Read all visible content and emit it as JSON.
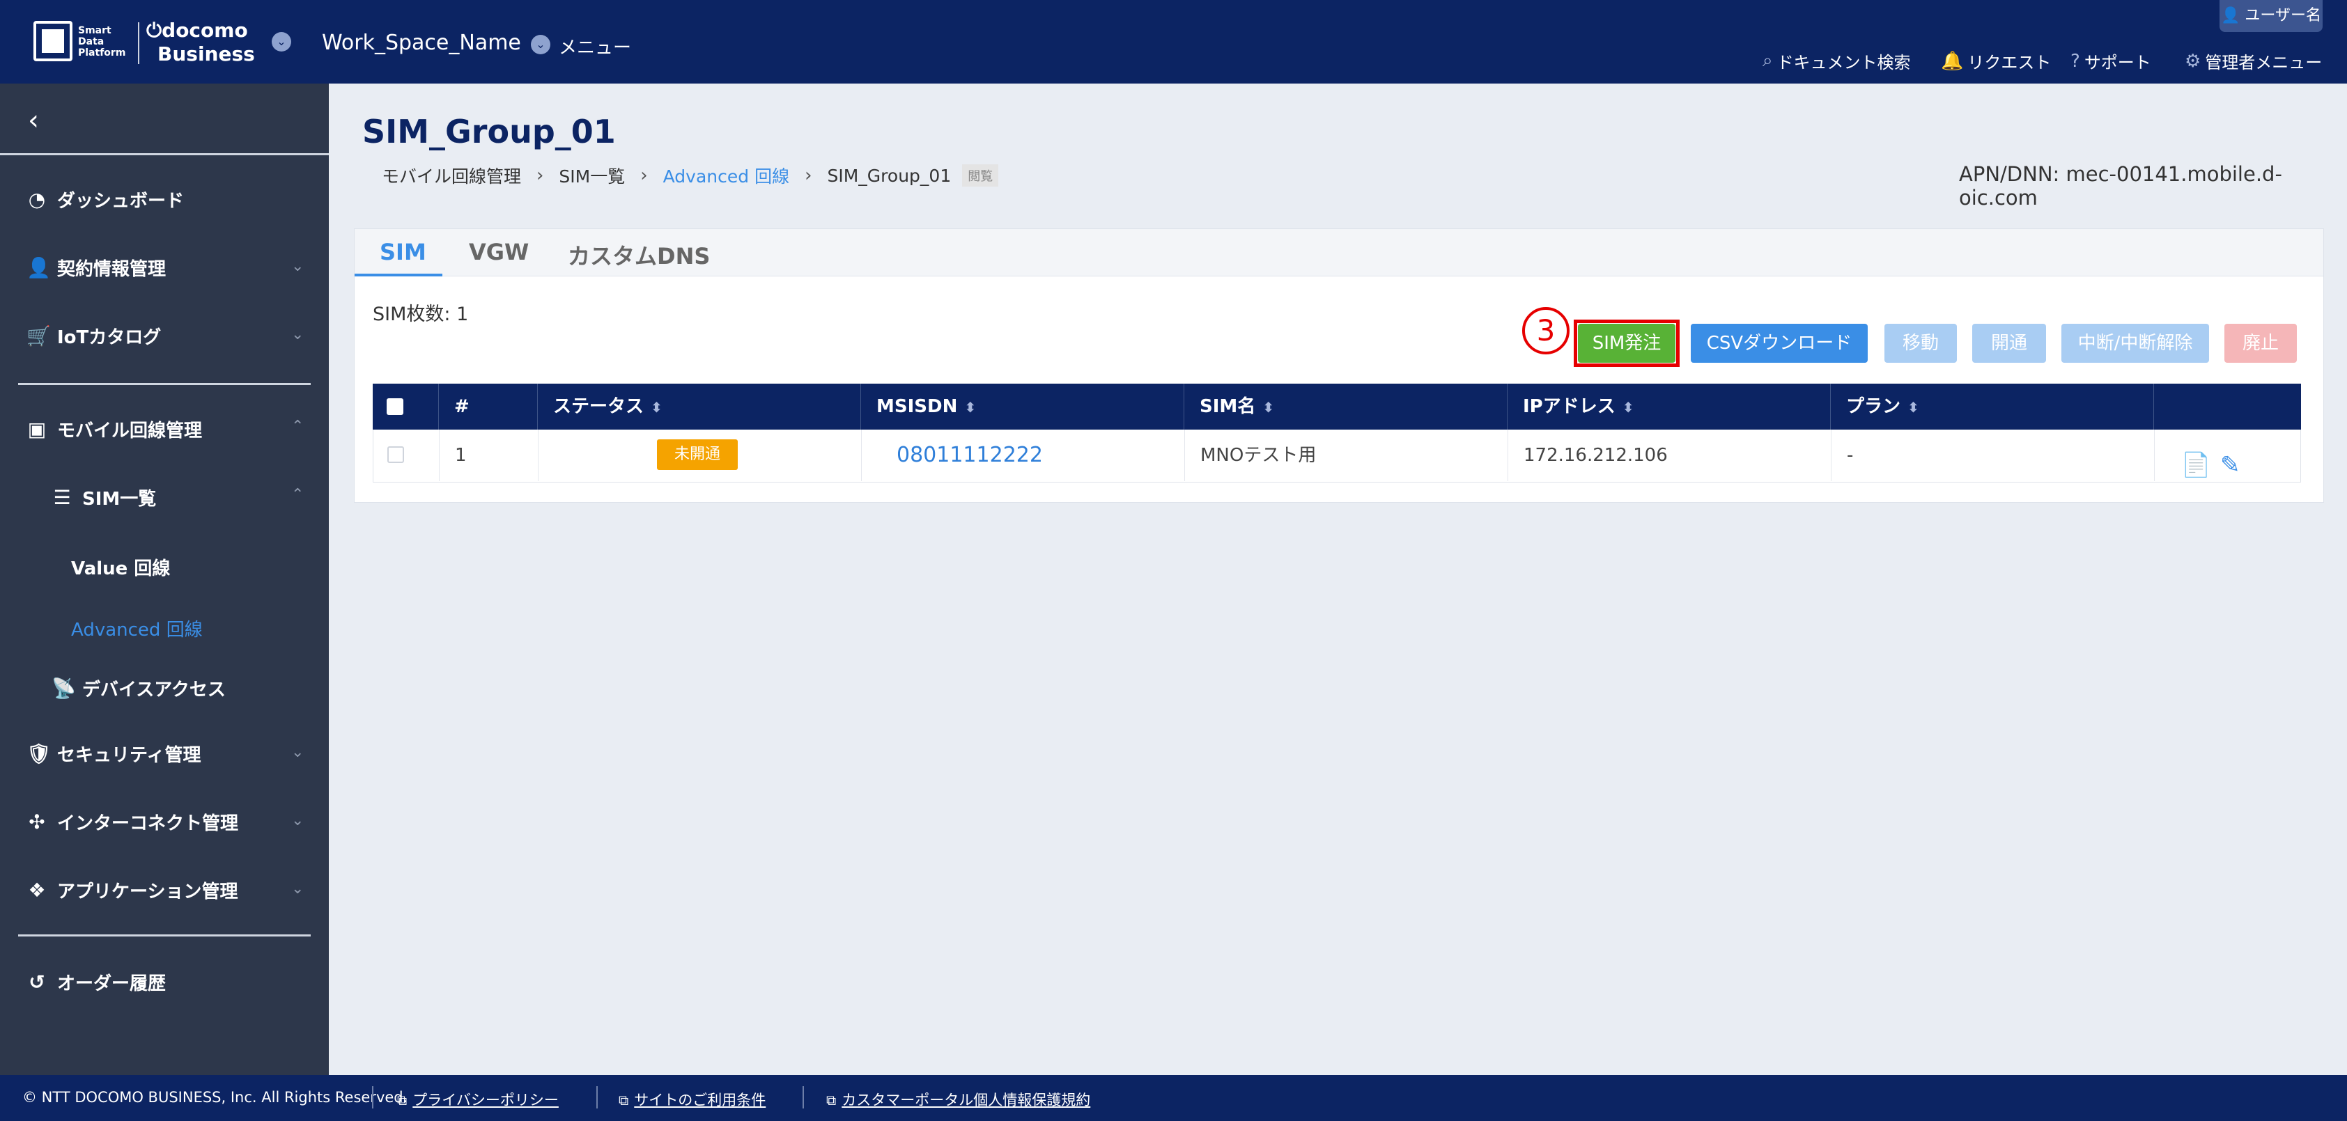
{
  "header": {
    "logo_sdp_line1": "Smart",
    "logo_sdp_line2": "Data",
    "logo_sdp_line3": "Platform",
    "logo_docomo": "docomo",
    "logo_business": "Business",
    "workspace": "Work_Space_Name",
    "menu_label": "メニュー",
    "user_name": "ユーザー名",
    "nav": {
      "doc_search": "ドキュメント検索",
      "request": "リクエスト",
      "support": "サポート",
      "admin_menu": "管理者メニュー"
    }
  },
  "sidebar": {
    "back_icon": "‹",
    "items": {
      "dashboard": "ダッシュボード",
      "contract": "契約情報管理",
      "iot_catalog": "IoTカタログ",
      "mobile": "モバイル回線管理",
      "sim_list": "SIM一覧",
      "value_line": "Value 回線",
      "advanced_line": "Advanced 回線",
      "device_access": "デバイスアクセス",
      "security": "セキュリティ管理",
      "interconnect": "インターコネクト管理",
      "application": "アプリケーション管理",
      "order_history": "オーダー履歴"
    }
  },
  "main": {
    "title": "SIM_Group_01",
    "breadcrumb": {
      "b1": "モバイル回線管理",
      "b2": "SIM一覧",
      "b3": "Advanced 回線",
      "b4": "SIM_Group_01",
      "tag": "閲覧"
    },
    "apn": "APN/DNN: mec-00141.mobile.d-oic.com",
    "tabs": {
      "t1": "SIM",
      "t2": "VGW",
      "t3": "カスタムDNS"
    },
    "sim_count": "SIM枚数: 1",
    "step_number": "3",
    "buttons": {
      "order": "SIM発注",
      "csv": "CSVダウンロード",
      "move": "移動",
      "open": "開通",
      "suspend": "中断/中断解除",
      "cancel": "廃止"
    },
    "table": {
      "headers": {
        "no": "#",
        "status": "ステータス",
        "msisdn": "MSISDN",
        "sim_name": "SIM名",
        "ip": "IPアドレス",
        "plan": "プラン"
      },
      "rows": [
        {
          "no": "1",
          "status": "未開通",
          "msisdn": "08011112222",
          "sim_name": "MNOテスト用",
          "ip": "172.16.212.106",
          "plan": "-"
        }
      ]
    }
  },
  "footer": {
    "copyright": "© NTT DOCOMO BUSINESS, Inc. All Rights Reserved.",
    "privacy": "プライバシーポリシー",
    "terms": "サイトのご利用条件",
    "customer_privacy": "カスタマーポータル個人情報保護規約"
  },
  "colors": {
    "navy": "#0c2463",
    "sidebar": "#2d374b",
    "accent_blue": "#3a8ee6",
    "green": "#58b236",
    "warning": "#f5a300",
    "highlight_red": "#e60000"
  }
}
